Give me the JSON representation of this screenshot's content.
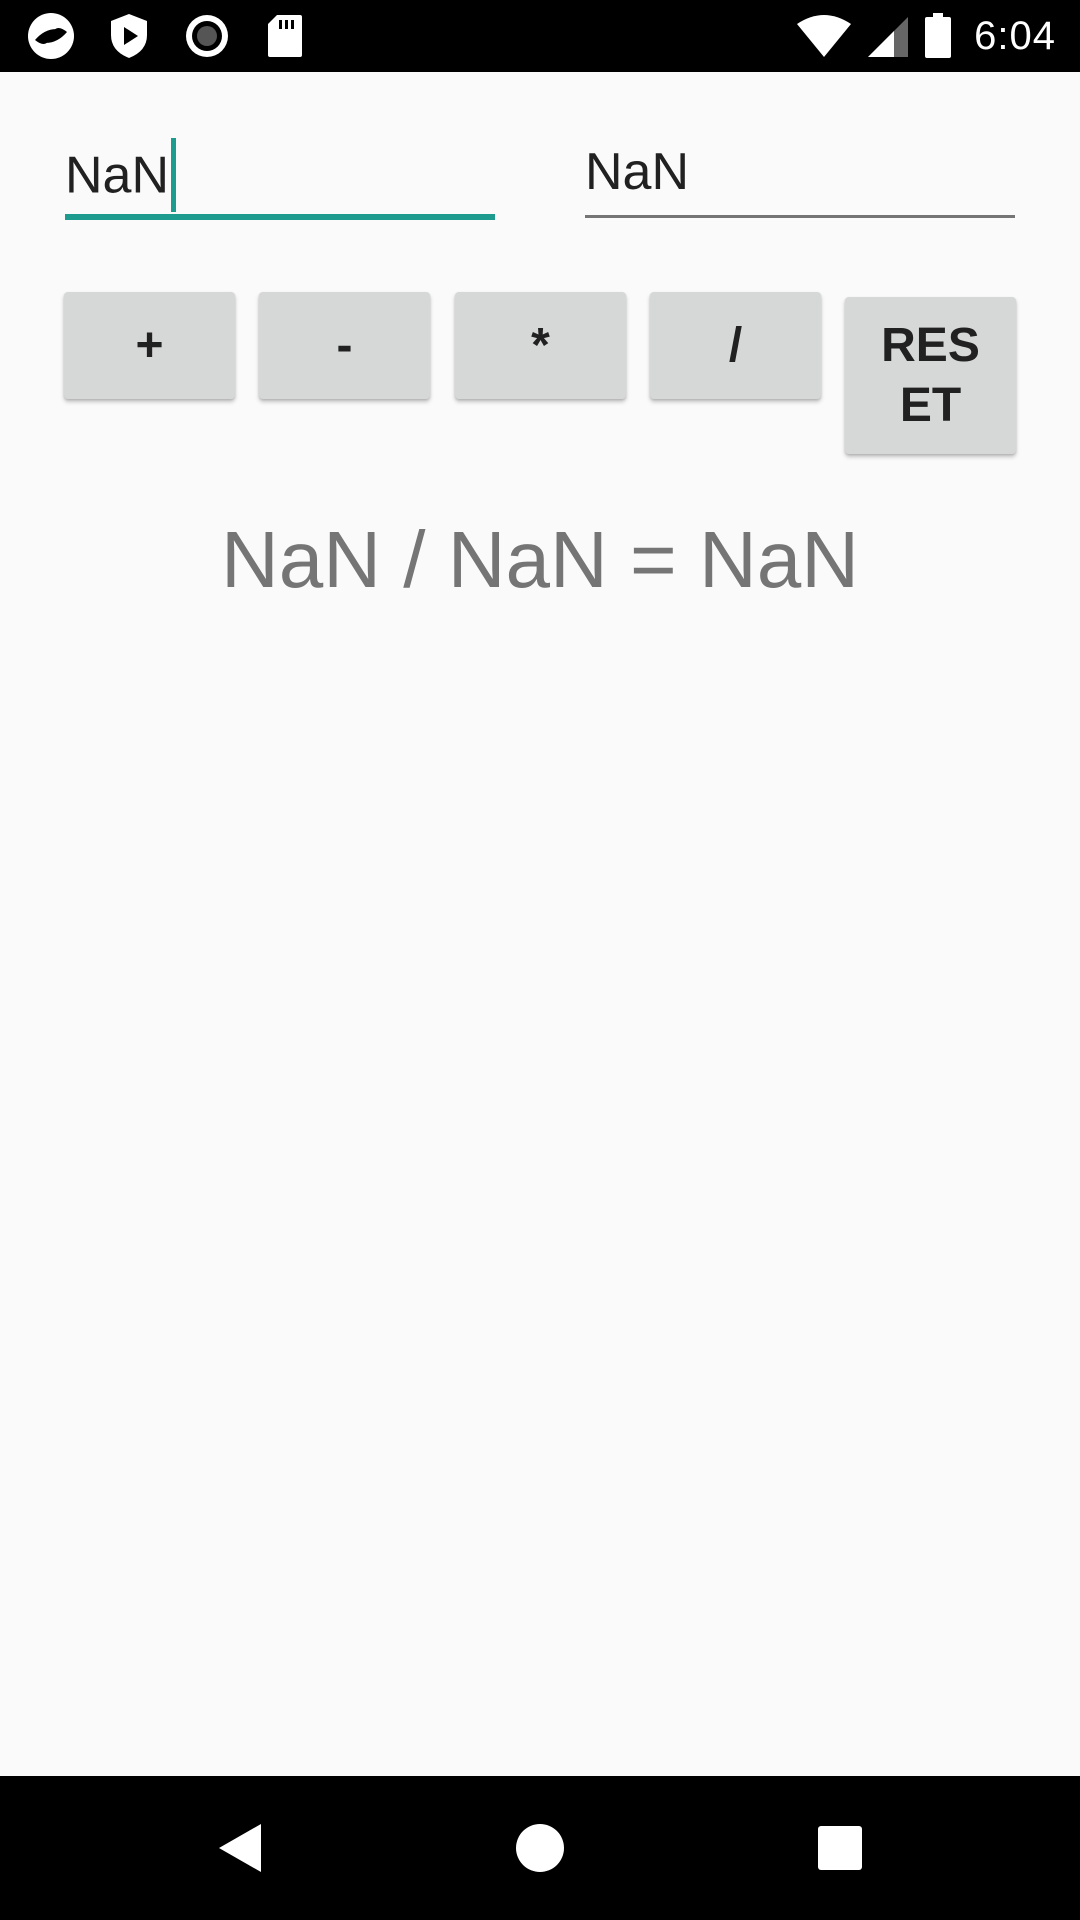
{
  "status_bar": {
    "time": "6:04",
    "left_icons": [
      "app-notification-icon",
      "shield-play-icon",
      "record-icon",
      "sd-card-icon"
    ],
    "right_icons": [
      "wifi-icon",
      "cell-signal-icon",
      "battery-icon"
    ]
  },
  "inputs": {
    "first_value": "NaN",
    "second_value": "NaN"
  },
  "buttons": {
    "add": "+",
    "subtract": "-",
    "multiply": "*",
    "divide": "/",
    "reset": "RESET"
  },
  "result": {
    "text": "NaN / NaN = NaN"
  },
  "nav_bar": {
    "icons": [
      "back-icon",
      "home-icon",
      "recents-icon"
    ]
  },
  "colors": {
    "accent": "#1e9b8f",
    "background": "#fafafa",
    "button": "#d6d7d7",
    "result_text": "#757575"
  }
}
